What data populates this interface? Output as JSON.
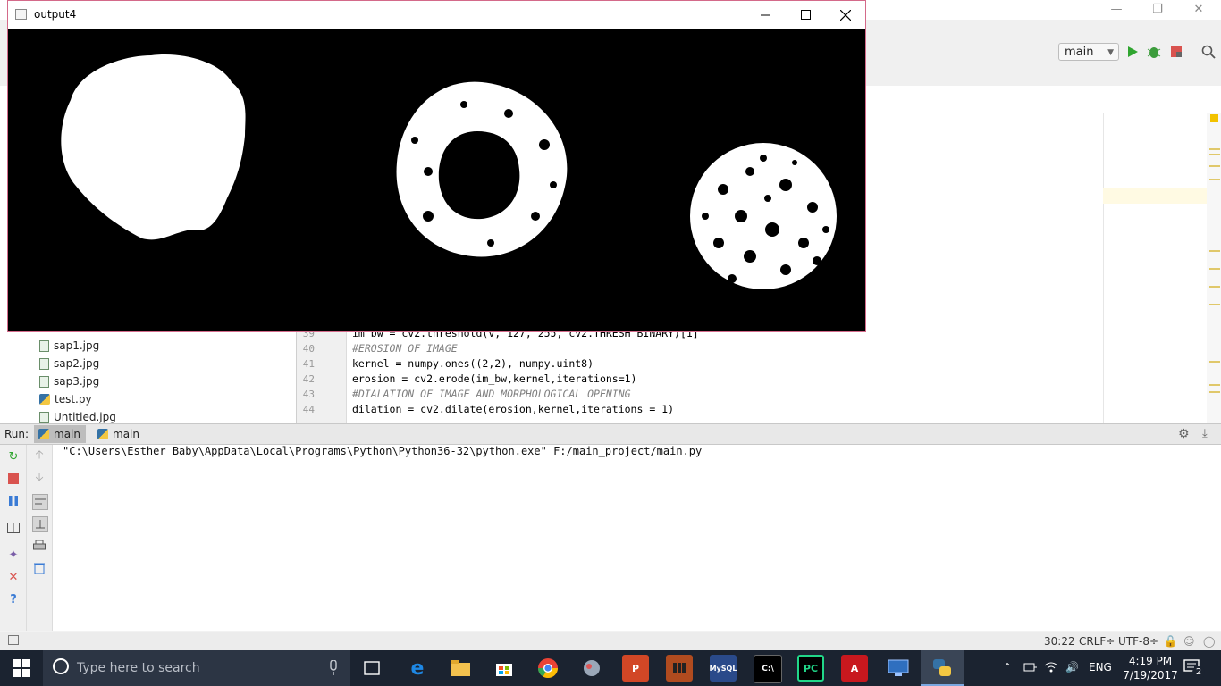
{
  "output_window": {
    "title": "output4",
    "controls": [
      "minimize",
      "maximize",
      "close"
    ]
  },
  "toolbar": {
    "run_config": "main"
  },
  "project_tree": {
    "items": [
      {
        "name": "sap1.jpg",
        "kind": "image"
      },
      {
        "name": "sap2.jpg",
        "kind": "image"
      },
      {
        "name": "sap3.jpg",
        "kind": "image"
      },
      {
        "name": "test.py",
        "kind": "python"
      },
      {
        "name": "Untitled.jpg",
        "kind": "image"
      }
    ]
  },
  "editor": {
    "lines": [
      {
        "no": "39",
        "text": "im_bw = cv2.threshold(v, 127, 255, cv2.THRESH_BINARY)[1]"
      },
      {
        "no": "40",
        "text": "#EROSION OF IMAGE",
        "comment": true
      },
      {
        "no": "41",
        "text": "kernel = numpy.ones((2,2), numpy.uint8)"
      },
      {
        "no": "42",
        "text": "erosion = cv2.erode(im_bw,kernel,iterations=1)"
      },
      {
        "no": "43",
        "text": "#DIALATION OF IMAGE AND MORPHOLOGICAL OPENING",
        "comment": true
      },
      {
        "no": "44",
        "text": "dilation = cv2.dilate(erosion,kernel,iterations = 1)"
      }
    ]
  },
  "run_panel": {
    "label": "Run:",
    "tabs": [
      "main",
      "main"
    ],
    "console_text": "\"C:\\Users\\Esther Baby\\AppData\\Local\\Programs\\Python\\Python36-32\\python.exe\" F:/main_project/main.py"
  },
  "status_bar": {
    "position": "30:22",
    "line_sep": "CRLF÷",
    "encoding": "UTF-8÷"
  },
  "taskbar": {
    "search_placeholder": "Type here to search",
    "apps": [
      {
        "name": "task-view",
        "label": ""
      },
      {
        "name": "edge",
        "label": "e",
        "color": "#1e88e5"
      },
      {
        "name": "file-explorer",
        "label": "",
        "color": "#f2c14e"
      },
      {
        "name": "store",
        "label": "",
        "color": "#ffffff"
      },
      {
        "name": "chrome",
        "label": "",
        "color": "#e94335"
      },
      {
        "name": "app-5",
        "label": "",
        "color": "#9aa7b8"
      },
      {
        "name": "powerpoint",
        "label": "P",
        "color": "#d24726"
      },
      {
        "name": "app-7",
        "label": "",
        "color": "#b04b1f"
      },
      {
        "name": "mysql",
        "label": "MySQL",
        "color": "#2a4a8a"
      },
      {
        "name": "cmd",
        "label": "C:\\",
        "color": "#000000"
      },
      {
        "name": "pycharm",
        "label": "PC",
        "color": "#21d789"
      },
      {
        "name": "acrobat",
        "label": "A",
        "color": "#c8181e"
      },
      {
        "name": "remote",
        "label": "",
        "color": "#2f6fbf"
      },
      {
        "name": "python",
        "label": "",
        "color": "#3572a5"
      }
    ],
    "language": "ENG",
    "time": "4:19 PM",
    "date": "7/19/2017",
    "notifications": "2"
  }
}
